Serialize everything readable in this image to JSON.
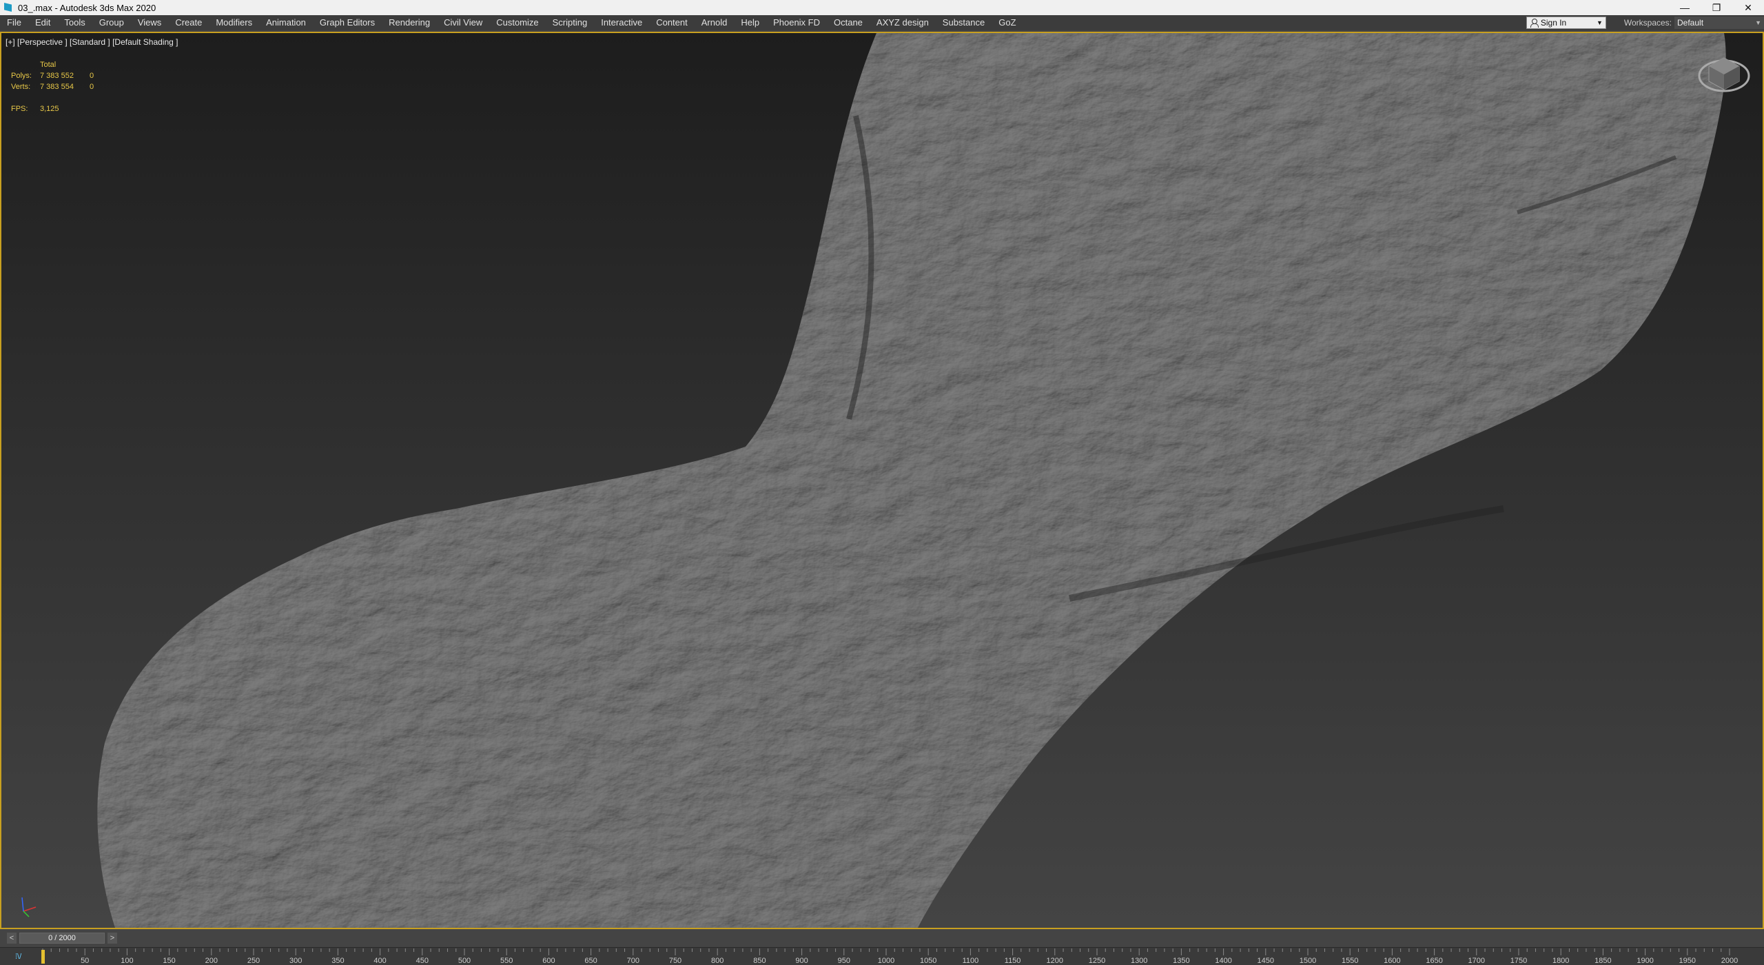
{
  "window": {
    "title": "03_.max - Autodesk 3ds Max 2020",
    "controls": {
      "minimize": "—",
      "restore": "❐",
      "close": "✕"
    }
  },
  "menu": {
    "items": [
      "File",
      "Edit",
      "Tools",
      "Group",
      "Views",
      "Create",
      "Modifiers",
      "Animation",
      "Graph Editors",
      "Rendering",
      "Civil View",
      "Customize",
      "Scripting",
      "Interactive",
      "Content",
      "Arnold",
      "Help",
      "Phoenix FD",
      "Octane",
      "AXYZ design",
      "Substance",
      "GoZ"
    ],
    "sign_in": "Sign In",
    "workspaces_label": "Workspaces:",
    "workspace_value": "Default"
  },
  "viewport": {
    "label": "[+] [Perspective ] [Standard ] [Default Shading ]",
    "stats": {
      "header": "Total",
      "polys_label": "Polys:",
      "polys_total": "7 383 552",
      "polys_selected": "0",
      "verts_label": "Verts:",
      "verts_total": "7 383 554",
      "verts_selected": "0",
      "fps_label": "FPS:",
      "fps_value": "3,125"
    },
    "accent_color": "#c8a020",
    "stats_color": "#e8c848"
  },
  "timeslider": {
    "prev": "<",
    "next": ">",
    "frame_display": "0 / 2000"
  },
  "trackbar": {
    "key_icon": "key-filter-icon",
    "ticks": [
      "50",
      "100",
      "150",
      "200",
      "250",
      "300",
      "350",
      "400",
      "450",
      "500",
      "550",
      "600",
      "650",
      "700",
      "750",
      "800",
      "850",
      "900",
      "950",
      "1000",
      "1050",
      "1100",
      "1150",
      "1200",
      "1250",
      "1300",
      "1350",
      "1400",
      "1450",
      "1500",
      "1550",
      "1600",
      "1650",
      "1700",
      "1750",
      "1800",
      "1850",
      "1900",
      "1950",
      "2000"
    ]
  }
}
